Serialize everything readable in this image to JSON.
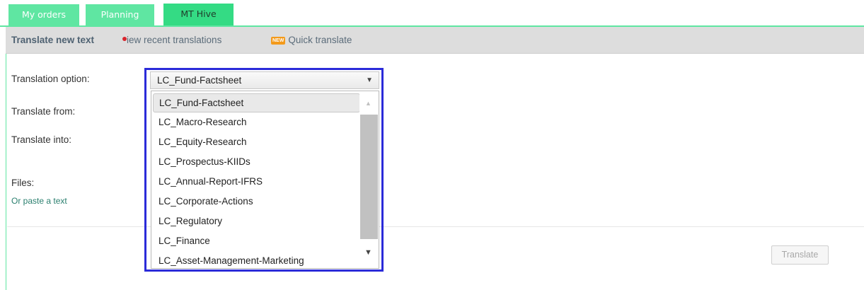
{
  "tabs": [
    {
      "label": "My orders"
    },
    {
      "label": "Planning"
    },
    {
      "label": "MT Hive"
    }
  ],
  "subnav": {
    "translate_new_text": "Translate new text",
    "view_recent": "View recent translations",
    "view_recent_rest": "iew recent translations",
    "new_badge": "NEW",
    "quick_translate": "Quick translate"
  },
  "form": {
    "translation_option_label": "Translation option:",
    "translate_from_label": "Translate from:",
    "translate_into_label": "Translate into:",
    "files_label": "Files:",
    "paste_text_link": "Or paste a text",
    "translate_button": "Translate"
  },
  "select": {
    "selected": "LC_Fund-Factsheet",
    "options": [
      "LC_Fund-Factsheet",
      "LC_Macro-Research",
      "LC_Equity-Research",
      "LC_Prospectus-KIIDs",
      "LC_Annual-Report-IFRS",
      "LC_Corporate-Actions",
      "LC_Regulatory",
      "LC_Finance",
      "LC_Asset-Management-Marketing"
    ]
  },
  "colors": {
    "tab_green": "#5fe6a2",
    "active_tab_green": "#34db84",
    "focus_blue": "#2b2bd9",
    "link_teal": "#2a7f6e"
  }
}
